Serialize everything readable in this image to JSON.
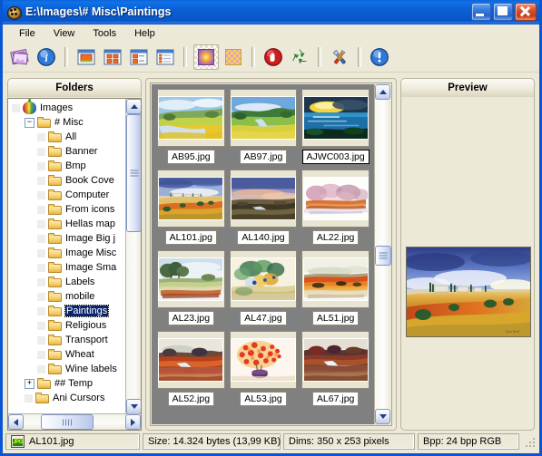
{
  "window": {
    "title": "E:\\Images\\# Misc\\Paintings",
    "icon": "app-palette-icon",
    "buttons": {
      "minimize": "Minimize",
      "maximize": "Maximize",
      "close": "Close"
    }
  },
  "menu": {
    "items": [
      "File",
      "View",
      "Tools",
      "Help"
    ]
  },
  "toolbar": {
    "groups": [
      {
        "items": [
          {
            "name": "thumbnails-icon",
            "title": "Thumbnails"
          },
          {
            "name": "info-icon",
            "title": "Image info"
          }
        ]
      },
      {
        "items": [
          {
            "name": "view-large-icons-icon",
            "title": "Large icons"
          },
          {
            "name": "view-thumbnails-icon",
            "title": "Thumbnails"
          },
          {
            "name": "view-list-icon",
            "title": "List"
          },
          {
            "name": "view-details-icon",
            "title": "Details"
          }
        ]
      },
      {
        "items": [
          {
            "name": "pattern-radial-icon",
            "title": "Background pattern",
            "checked": true
          },
          {
            "name": "pattern-checker-icon",
            "title": "Checker pattern",
            "checked": false
          }
        ]
      },
      {
        "items": [
          {
            "name": "stop-icon",
            "title": "Stop"
          },
          {
            "name": "recycle-icon",
            "title": "Recycle bin"
          }
        ]
      },
      {
        "items": [
          {
            "name": "tools-icon",
            "title": "Options"
          }
        ]
      },
      {
        "items": [
          {
            "name": "about-icon",
            "title": "About"
          }
        ]
      }
    ]
  },
  "folders": {
    "header": "Folders",
    "tree": [
      {
        "label": "Images",
        "depth": 0,
        "icon": "root",
        "expander": "none",
        "selected": false
      },
      {
        "label": "# Misc",
        "depth": 1,
        "icon": "folder",
        "expander": "minus",
        "selected": false
      },
      {
        "label": "All",
        "depth": 2,
        "icon": "folder",
        "expander": "none",
        "selected": false
      },
      {
        "label": "Banner",
        "depth": 2,
        "icon": "folder",
        "expander": "none",
        "selected": false
      },
      {
        "label": "Bmp",
        "depth": 2,
        "icon": "folder",
        "expander": "none",
        "selected": false
      },
      {
        "label": "Book Cove",
        "depth": 2,
        "icon": "folder",
        "expander": "none",
        "selected": false
      },
      {
        "label": "Computer",
        "depth": 2,
        "icon": "folder",
        "expander": "none",
        "selected": false
      },
      {
        "label": "From icons",
        "depth": 2,
        "icon": "folder",
        "expander": "none",
        "selected": false
      },
      {
        "label": "Hellas map",
        "depth": 2,
        "icon": "folder",
        "expander": "none",
        "selected": false
      },
      {
        "label": "Image Big j",
        "depth": 2,
        "icon": "folder",
        "expander": "none",
        "selected": false
      },
      {
        "label": "Image Misc",
        "depth": 2,
        "icon": "folder",
        "expander": "none",
        "selected": false
      },
      {
        "label": "Image Sma",
        "depth": 2,
        "icon": "folder",
        "expander": "none",
        "selected": false
      },
      {
        "label": "Labels",
        "depth": 2,
        "icon": "folder",
        "expander": "none",
        "selected": false
      },
      {
        "label": "mobile",
        "depth": 2,
        "icon": "folder",
        "expander": "none",
        "selected": false
      },
      {
        "label": "Paintings",
        "depth": 2,
        "icon": "folder",
        "expander": "none",
        "selected": true
      },
      {
        "label": "Religious",
        "depth": 2,
        "icon": "folder",
        "expander": "none",
        "selected": false
      },
      {
        "label": "Transport",
        "depth": 2,
        "icon": "folder",
        "expander": "none",
        "selected": false
      },
      {
        "label": "Wheat",
        "depth": 2,
        "icon": "folder",
        "expander": "none",
        "selected": false
      },
      {
        "label": "Wine labels",
        "depth": 2,
        "icon": "folder",
        "expander": "none",
        "selected": false
      },
      {
        "label": "## Temp",
        "depth": 1,
        "icon": "folder",
        "expander": "plus",
        "selected": false
      },
      {
        "label": "Ani Cursors",
        "depth": 1,
        "icon": "folder",
        "expander": "none",
        "selected": false
      }
    ]
  },
  "thumbnails": {
    "items": [
      {
        "file": "AB95.jpg",
        "art": "art-fields-river",
        "selected": false
      },
      {
        "file": "AB97.jpg",
        "art": "art-green-valley",
        "selected": false
      },
      {
        "file": "AJWC003.jpg",
        "art": "art-dark-sunset-sea",
        "selected": true
      },
      {
        "file": "AL101.jpg",
        "art": "art-tuscany",
        "selected": false
      },
      {
        "file": "AL140.jpg",
        "art": "art-dusk-marsh",
        "selected": false
      },
      {
        "file": "AL22.jpg",
        "art": "art-pink-autumn",
        "selected": false
      },
      {
        "file": "AL23.jpg",
        "art": "art-trees-meadow",
        "selected": false
      },
      {
        "file": "AL47.jpg",
        "art": "art-green-bouquet",
        "selected": false
      },
      {
        "file": "AL51.jpg",
        "art": "art-orange-field",
        "selected": false
      },
      {
        "file": "AL52.jpg",
        "art": "art-red-river",
        "selected": false
      },
      {
        "file": "AL53.jpg",
        "art": "art-red-flowers",
        "selected": false
      },
      {
        "file": "AL67.jpg",
        "art": "art-autumn-stream",
        "selected": false
      }
    ]
  },
  "preview": {
    "header": "Preview",
    "image_alt": "AL101.jpg"
  },
  "status": {
    "file": "AL101.jpg",
    "file_icon": "jpg-file-icon",
    "size": "Size: 14.324 bytes  (13,99 KB)",
    "dims": "Dims: 350 x 253 pixels",
    "bpp": "Bpp: 24 bpp RGB"
  },
  "colors": {
    "title_blue": "#0b5fd5",
    "face": "#ece9d8",
    "thumb_bg": "#808080",
    "selection": "#0a246a",
    "tile_bg": "#e8e5d2"
  }
}
